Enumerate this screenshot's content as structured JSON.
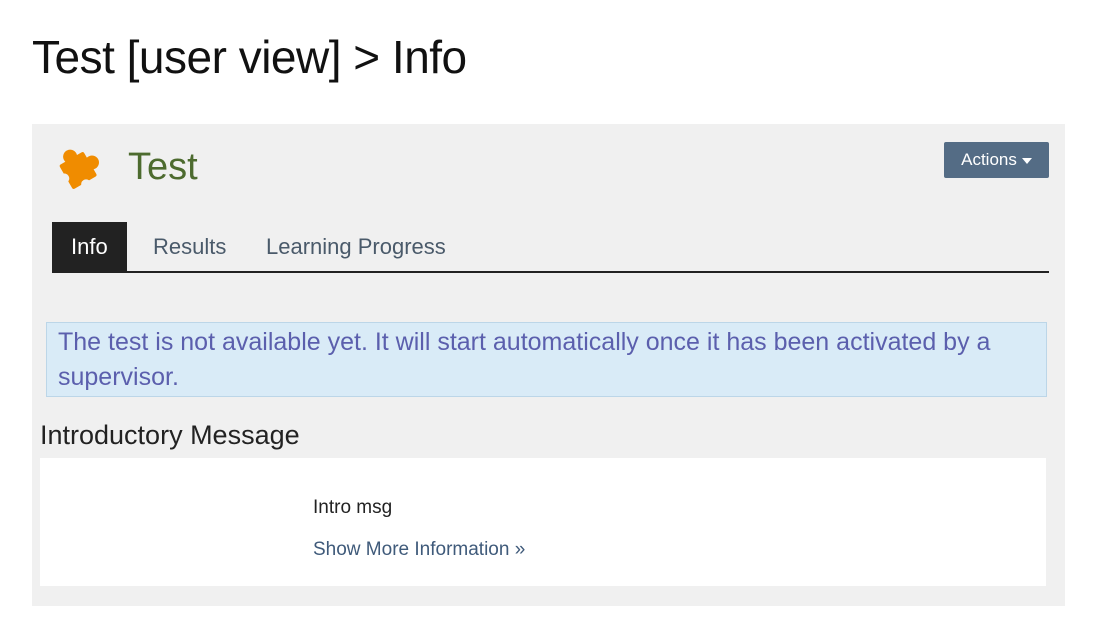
{
  "page": {
    "heading": "Test [user view] > Info"
  },
  "object": {
    "title": "Test",
    "icon": "puzzle-icon",
    "icon_color": "#f08c00"
  },
  "actions": {
    "label": "Actions"
  },
  "tabs": [
    {
      "label": "Info",
      "active": true
    },
    {
      "label": "Results",
      "active": false
    },
    {
      "label": "Learning Progress",
      "active": false
    }
  ],
  "alert": {
    "message": "The test is not available yet. It will start automatically once it has been activated by a supervisor."
  },
  "intro": {
    "section_title": "Introductory Message",
    "message": "Intro msg",
    "more_link": "Show More Information »"
  },
  "colors": {
    "accent": "#546c85",
    "title_green": "#4d6b2f",
    "alert_bg": "#d9ebf7",
    "alert_text": "#5b5fad"
  }
}
